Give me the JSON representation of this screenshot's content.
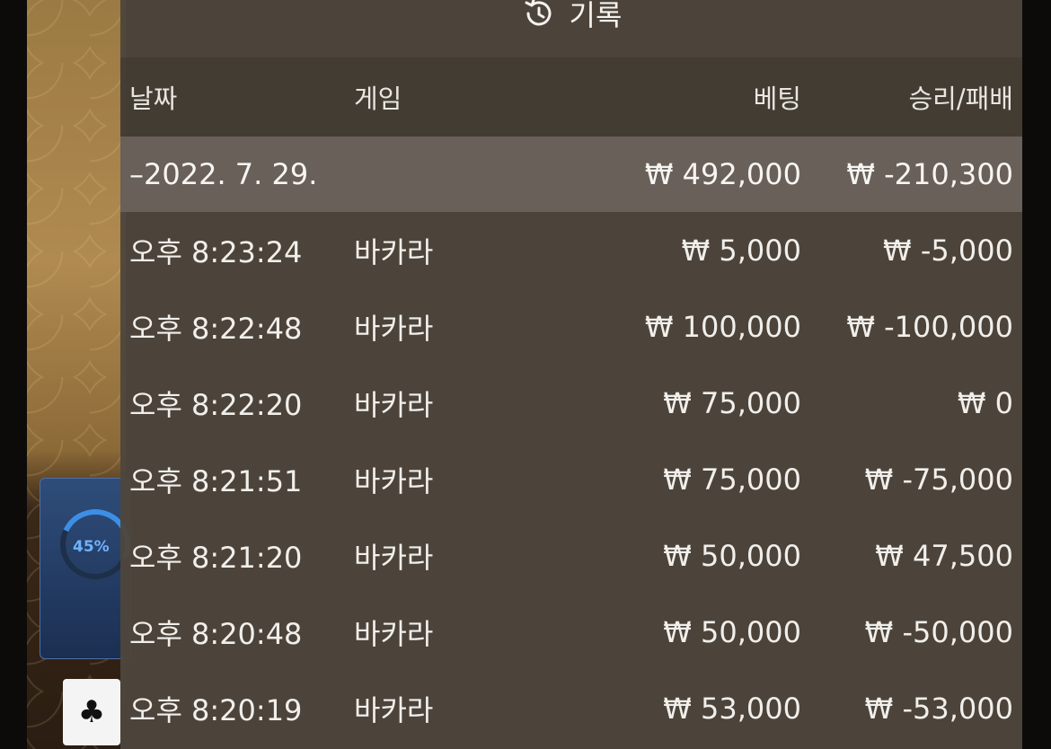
{
  "background": {
    "progress_percent": "45%",
    "card_suit_icon": "club-icon"
  },
  "panel": {
    "title": "기록",
    "title_icon": "history-icon",
    "columns": {
      "date": "날짜",
      "game": "게임",
      "bet": "베팅",
      "result": "승리/패배"
    },
    "summary": {
      "date": "–2022. 7. 29.",
      "bet": "₩ 492,000",
      "result": "₩ -210,300"
    },
    "rows": [
      {
        "time": "오후 8:23:24",
        "game": "바카라",
        "bet": "₩ 5,000",
        "result": "₩ -5,000"
      },
      {
        "time": "오후 8:22:48",
        "game": "바카라",
        "bet": "₩ 100,000",
        "result": "₩ -100,000"
      },
      {
        "time": "오후 8:22:20",
        "game": "바카라",
        "bet": "₩ 75,000",
        "result": "₩ 0"
      },
      {
        "time": "오후 8:21:51",
        "game": "바카라",
        "bet": "₩ 75,000",
        "result": "₩ -75,000"
      },
      {
        "time": "오후 8:21:20",
        "game": "바카라",
        "bet": "₩ 50,000",
        "result": "₩ 47,500"
      },
      {
        "time": "오후 8:20:48",
        "game": "바카라",
        "bet": "₩ 50,000",
        "result": "₩ -50,000"
      },
      {
        "time": "오후 8:20:19",
        "game": "바카라",
        "bet": "₩ 53,000",
        "result": "₩ -53,000"
      }
    ]
  }
}
